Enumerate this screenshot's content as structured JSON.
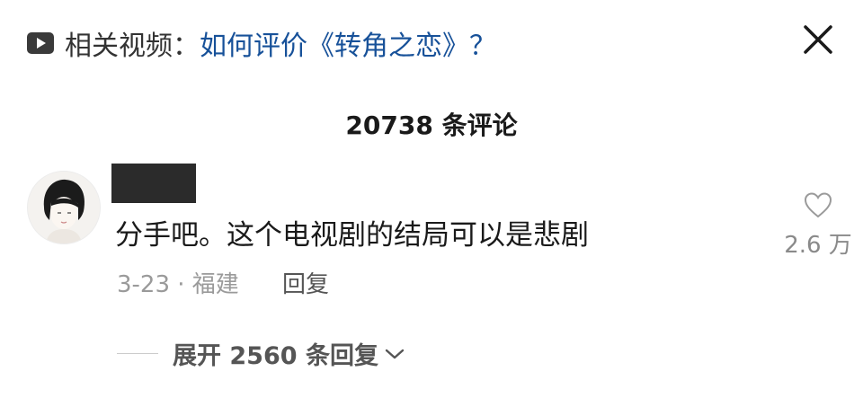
{
  "header": {
    "label": "相关视频：",
    "video_title": "如何评价《转角之恋》？",
    "video_icon": "video-play-icon",
    "close_icon": "close-icon"
  },
  "comments_count": "20738 条评论",
  "comment": {
    "text": "分手吧。这个电视剧的结局可以是悲剧",
    "date_location": "3-23 · 福建",
    "reply_label": "回复",
    "like_count": "2.6 万",
    "expand_replies": "展开 2560 条回复"
  },
  "colors": {
    "link": "#175199",
    "muted": "#9a9a9a",
    "text": "#1a1a1a"
  }
}
